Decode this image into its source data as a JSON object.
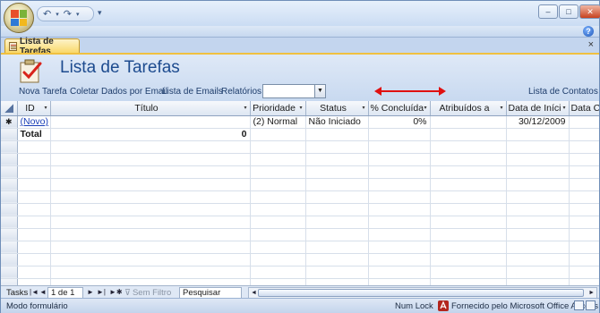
{
  "window": {
    "title": "",
    "minimize_label": "–",
    "restore_label": "□",
    "close_label": "✕"
  },
  "qat": {
    "undo": "↶",
    "redo": "↷",
    "more": "▾"
  },
  "help": {
    "label": "?"
  },
  "doc_tab": {
    "label": "Lista de Tarefas",
    "close": "×"
  },
  "form": {
    "title": "Lista de Tarefas",
    "commands": {
      "new_task": "Nova Tarefa",
      "collect_email": "Coletar Dados por Email",
      "email_list": "Lista de Emails",
      "reports": "Relatórios",
      "contacts": "Lista de Contatos"
    },
    "reports_select_value": "",
    "annotation_color": "#e01010"
  },
  "table": {
    "columns": [
      "ID",
      "Título",
      "Prioridade",
      "Status",
      "% Concluída",
      "Atribuídos a",
      "Data de Iníci",
      "Data Co"
    ],
    "new_row": {
      "marker": "✱",
      "id": "(Novo)",
      "title": "",
      "priority": "(2) Normal",
      "status": "Não Iniciado",
      "percent": "0%",
      "assigned": "",
      "start": "30/12/2009",
      "due": ""
    },
    "total_row": {
      "label": "Total",
      "title_value": "0"
    }
  },
  "navbar": {
    "label": "Tasks",
    "first": "|◄",
    "prev": "◄",
    "record": "1 de 1",
    "next": "►",
    "last": "►|",
    "new": "►✱",
    "filter": "Sem Filtro",
    "search": "Pesquisar"
  },
  "statusbar": {
    "mode": "Modo formulário",
    "numlock": "Num Lock",
    "brand": "Fornecido pelo Microsoft Office Access"
  }
}
